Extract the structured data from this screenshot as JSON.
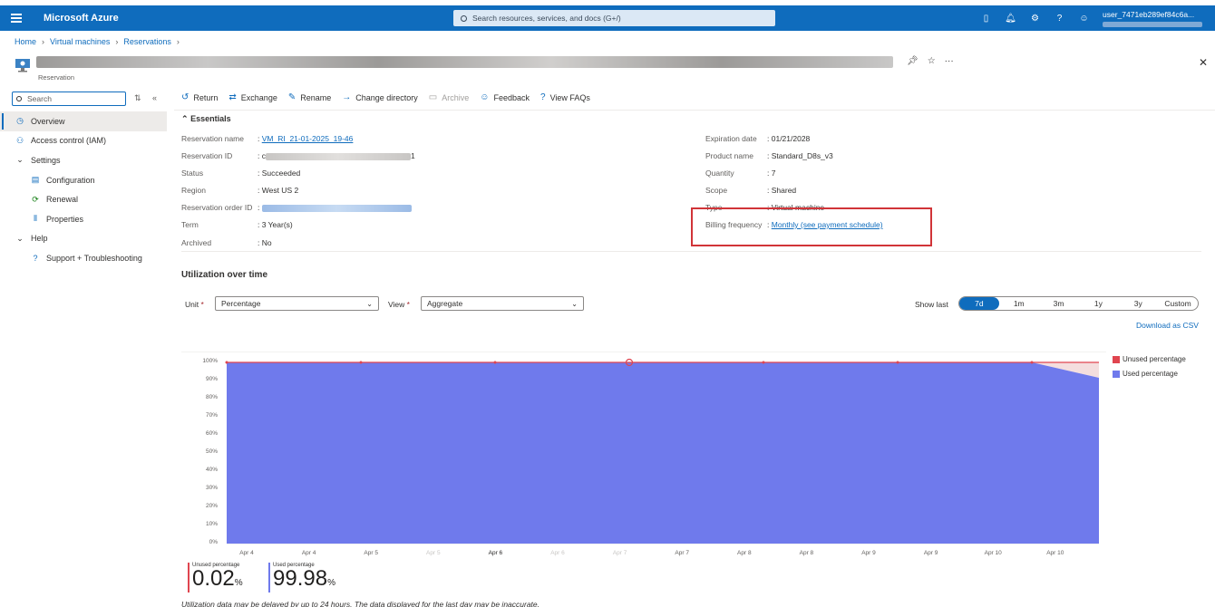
{
  "topbar": {
    "brand": "Microsoft Azure",
    "search_placeholder": "Search resources, services, and docs (G+/)",
    "user": "user_7471eb289ef84c6a..."
  },
  "breadcrumb": [
    "Home",
    "Virtual machines",
    "Reservations"
  ],
  "header": {
    "subtitle": "Reservation"
  },
  "sidebar": {
    "search_placeholder": "Search",
    "items": [
      {
        "label": "Overview",
        "icon": "overview-icon",
        "indent": 0,
        "active": true
      },
      {
        "label": "Access control (IAM)",
        "icon": "people-icon",
        "indent": 0
      },
      {
        "label": "Settings",
        "icon": "chevron-down-icon",
        "indent": 0
      },
      {
        "label": "Configuration",
        "icon": "config-icon",
        "indent": 1
      },
      {
        "label": "Renewal",
        "icon": "renewal-icon",
        "indent": 1
      },
      {
        "label": "Properties",
        "icon": "properties-icon",
        "indent": 1
      },
      {
        "label": "Help",
        "icon": "chevron-down-icon",
        "indent": 0
      },
      {
        "label": "Support + Troubleshooting",
        "icon": "support-icon",
        "indent": 1
      }
    ]
  },
  "toolbar": {
    "return": "Return",
    "exchange": "Exchange",
    "rename": "Rename",
    "change_directory": "Change directory",
    "archive": "Archive",
    "feedback": "Feedback",
    "faqs": "View FAQs"
  },
  "essentials": {
    "title": "Essentials",
    "left": {
      "reservation_name_label": "Reservation name",
      "reservation_name": "VM_RI_21-01-2025_19-46",
      "reservation_id_label": "Reservation ID",
      "reservation_id_start": "c",
      "reservation_id_end": "1",
      "status_label": "Status",
      "status": "Succeeded",
      "region_label": "Region",
      "region": "West US 2",
      "order_id_label": "Reservation order ID",
      "term_label": "Term",
      "term": "3 Year(s)",
      "archived_label": "Archived",
      "archived": "No"
    },
    "right": {
      "expiration_label": "Expiration date",
      "expiration": "01/21/2028",
      "product_label": "Product name",
      "product": "Standard_D8s_v3",
      "quantity_label": "Quantity",
      "quantity": "7",
      "scope_label": "Scope",
      "scope": "Shared",
      "type_label": "Type",
      "type": "Virtual machine",
      "billing_label": "Billing frequency",
      "billing": "Monthly (see payment schedule)"
    }
  },
  "utilization": {
    "title": "Utilization over time",
    "unit_label": "Unit",
    "unit_value": "Percentage",
    "view_label": "View",
    "view_value": "Aggregate",
    "show_last_label": "Show last",
    "ranges": [
      "7d",
      "1m",
      "3m",
      "1y",
      "3y",
      "Custom"
    ],
    "selected_range": "7d",
    "download": "Download as CSV",
    "unused_kpi_label": "Unused percentage",
    "unused_kpi_value": "0.02",
    "used_kpi_label": "Used percentage",
    "used_kpi_value": "99.98",
    "kpi_unit": "%",
    "note": "Utilization data may be delayed by up to 24 hours. The data displayed for the last day may be inaccurate."
  },
  "colors": {
    "accent": "#0f6cbd",
    "unused": "#e0454f",
    "used": "#6f7aec",
    "highlight": "#d13438"
  },
  "chart_data": {
    "type": "area",
    "x": [
      "Apr 4",
      "Apr 4",
      "Apr 5",
      "Apr 5",
      "Apr 6",
      "Apr 6",
      "Apr 7",
      "Apr 7",
      "Apr 8",
      "Apr 8",
      "Apr 9",
      "Apr 9",
      "Apr 10",
      "Apr 10"
    ],
    "x_tick_labels": [
      "Apr 4",
      "Apr 4",
      "Apr 5",
      "Apr 5",
      "Apr 6",
      "Apr 6",
      "Apr 7",
      "Apr 7",
      "Apr 8",
      "Apr 8",
      "Apr 9",
      "Apr 9",
      "Apr 10",
      "Apr 10"
    ],
    "y_tick_labels": [
      "100%",
      "90%",
      "80%",
      "70%",
      "60%",
      "50%",
      "40%",
      "30%",
      "20%",
      "10%",
      "0%"
    ],
    "series": [
      {
        "name": "Unused percentage",
        "values": [
          0,
          0,
          0,
          0,
          0,
          0,
          0,
          0,
          0,
          0,
          0,
          0,
          0,
          8.5
        ]
      },
      {
        "name": "Used percentage",
        "values": [
          100,
          100,
          100,
          100,
          100,
          100,
          100,
          100,
          100,
          100,
          100,
          100,
          100,
          91.5
        ]
      }
    ],
    "ylim": [
      0,
      100
    ],
    "legend": "right"
  }
}
